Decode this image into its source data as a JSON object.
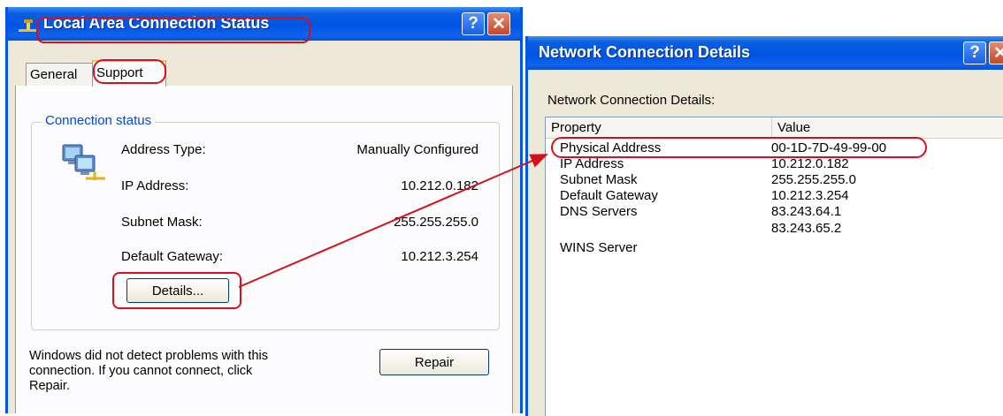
{
  "status_window": {
    "title": "Local Area Connection Status",
    "help_glyph": "?",
    "close_glyph": "✕",
    "tabs": [
      "General",
      "Support"
    ],
    "group_title": "Connection status",
    "rows": [
      {
        "label": "Address Type:",
        "value": "Manually Configured"
      },
      {
        "label": "IP Address:",
        "value": "10.212.0.182"
      },
      {
        "label": "Subnet Mask:",
        "value": "255.255.255.0"
      },
      {
        "label": "Default Gateway:",
        "value": "10.212.3.254"
      }
    ],
    "details_button": "Details...",
    "message": [
      "Windows did not detect problems with this",
      "connection. If you cannot connect, click",
      "Repair."
    ],
    "repair_button": "Repair"
  },
  "details_window": {
    "title": "Network Connection Details",
    "help_glyph": "?",
    "close_glyph": "✕",
    "heading": "Network Connection Details:",
    "columns": [
      "Property",
      "Value"
    ],
    "rows": [
      {
        "property": "Physical Address",
        "value": "00-1D-7D-49-99-00"
      },
      {
        "property": "IP Address",
        "value": "10.212.0.182"
      },
      {
        "property": "Subnet Mask",
        "value": "255.255.255.0"
      },
      {
        "property": "Default Gateway",
        "value": "10.212.3.254"
      },
      {
        "property": "DNS Servers",
        "value": "83.243.64.1"
      },
      {
        "property": "",
        "value": "83.243.65.2"
      },
      {
        "property": "WINS Server",
        "value": ""
      }
    ]
  },
  "annotation_color": "#d6101c"
}
